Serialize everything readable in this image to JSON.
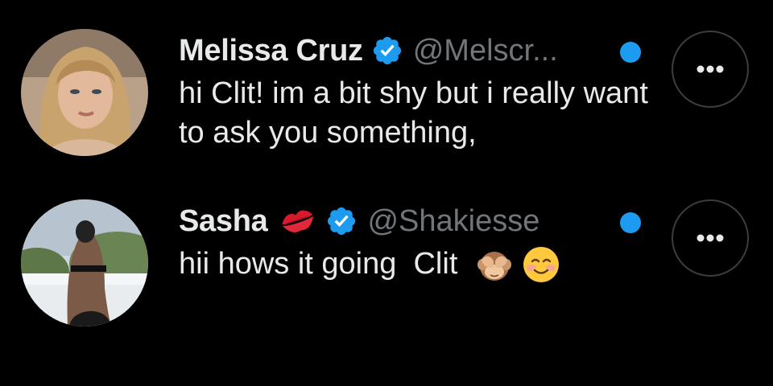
{
  "conversations": [
    {
      "display_name": "Melissa Cruz",
      "handle": "@Melscr...",
      "verified": true,
      "message": "hi Clit! im a bit shy but i really want to ask you something,",
      "unread": true
    },
    {
      "display_name": "Sasha",
      "name_emoji": "kiss-mark",
      "handle": "@Shakiesse",
      "verified": true,
      "message": "hii hows it going  Clit",
      "message_emojis": [
        "see-no-evil-monkey",
        "smiling-face"
      ],
      "unread": true
    }
  ],
  "colors": {
    "background": "#000000",
    "primary_text": "#e7e9ea",
    "secondary_text": "#71767b",
    "accent_blue": "#1d9bf0",
    "button_border": "#3a3d41"
  }
}
